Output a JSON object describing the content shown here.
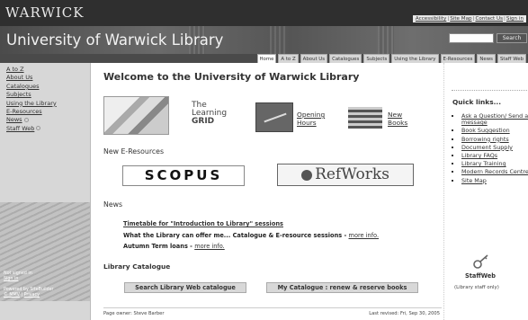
{
  "header": {
    "brand": "WARWICK",
    "links": [
      "Accessibility",
      "Site Map",
      "Contact Us",
      "Sign in"
    ],
    "site_title": "University of Warwick Library",
    "search_button": "Search",
    "search_value": ""
  },
  "nav_tabs": [
    "Home",
    "A to Z",
    "About Us",
    "Catalogues",
    "Subjects",
    "Using the Library",
    "E-Resources",
    "News",
    "Staff Web"
  ],
  "sidebar": {
    "items": [
      "A to Z",
      "About Us",
      "Catalogues",
      "Subjects",
      "Using the Library",
      "E-Resources",
      "News",
      "Staff Web"
    ],
    "status": "Not signed in",
    "sign_in": "Sign in",
    "powered_by": "Powered by SiteBuilder",
    "copyright": "© MMV",
    "privacy": "Privacy"
  },
  "main": {
    "title": "Welcome to the University of Warwick Library",
    "learning_grid": [
      "The",
      "Learning",
      "GRID"
    ],
    "opening_hours": [
      "Opening",
      "Hours"
    ],
    "new_books": [
      "New",
      "Books"
    ],
    "eresources_heading": "New E-Resources",
    "scopus": "SCOPUS",
    "refworks": "RefWorks",
    "news_heading": "News",
    "news": [
      {
        "text": "Timetable for \"Introduction to Library\" sessions",
        "more": ""
      },
      {
        "text": "What the Library can offer me... Catalogue & E-resource sessions - ",
        "more": "more info."
      },
      {
        "text": "Autumn Term loans - ",
        "more": "more info."
      }
    ],
    "catalogue_heading": "Library Catalogue",
    "btn_search_catalogue": "Search Library Web catalogue",
    "btn_my_catalogue": "My Catalogue : renew & reserve books",
    "page_owner": "Page owner: Steve Barber",
    "last_revised": "Last revised: Fri, Sep 30, 2005"
  },
  "quick_links": {
    "title": "Quick links...",
    "items": [
      "Ask a Question/ Send a message",
      "Book Suggestion",
      "Borrowing rights",
      "Document Supply",
      "Library FAQs",
      "Library Training",
      "Modern Records Centre",
      "Site Map"
    ],
    "staff_title": "StaffWeb",
    "staff_sub": "(Library staff only)"
  }
}
